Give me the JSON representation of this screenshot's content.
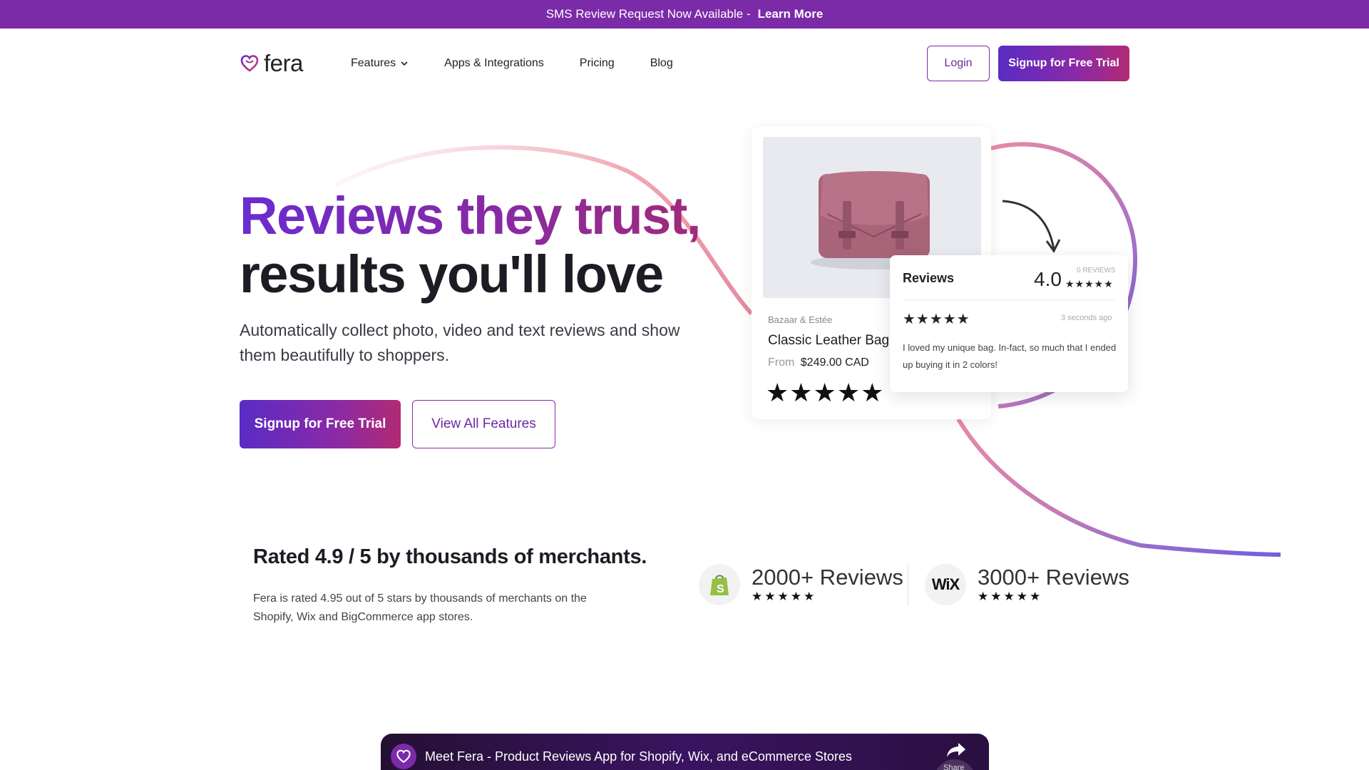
{
  "announcement": {
    "text": "SMS Review Request Now Available -",
    "link": "Learn More"
  },
  "header": {
    "logo_text": "fera",
    "nav": [
      {
        "label": "Features"
      },
      {
        "label": "Apps & Integrations"
      },
      {
        "label": "Pricing"
      },
      {
        "label": "Blog"
      }
    ],
    "login_label": "Login",
    "signup_label": "Signup for Free Trial"
  },
  "hero": {
    "title_line1": "Reviews they trust,",
    "title_line2": "results you'll love",
    "subtitle": "Automatically collect photo, video and text reviews and show them beautifully to shoppers.",
    "primary_cta": "Signup for Free Trial",
    "secondary_cta": "View All Features"
  },
  "product_card": {
    "brand": "Bazaar & Estée",
    "name": "Classic Leather Bag",
    "price_prefix": "From",
    "price": "$249.00 CAD",
    "stars": "★★★★★",
    "rating_value": 5
  },
  "reviews_widget": {
    "title": "Reviews",
    "score": "4.0",
    "count_label": "0 REVIEWS",
    "mini_stars": "★★★★★",
    "review_stars": "★★★★★",
    "time": "3 seconds ago",
    "text": "I loved my unique bag. In-fact, so much that I ended up buying it in 2 colors!"
  },
  "rated": {
    "title": "Rated 4.9 / 5 by thousands of merchants.",
    "text": "Fera is rated 4.95 out of 5 stars by thousands of merchants on the Shopify, Wix and BigCommerce app stores."
  },
  "badges": {
    "shopify": {
      "count": "2000+ Reviews",
      "stars": "★★★★★"
    },
    "wix": {
      "logo": "WiX",
      "count": "3000+ Reviews",
      "stars": "★★★★★"
    }
  },
  "video": {
    "title": "Meet Fera - Product Reviews App for Shopify, Wix, and eCommerce Stores",
    "share_label": "Share"
  },
  "colors": {
    "brand_purple": "#7b2aa8",
    "gradient_start": "#5a2bc4",
    "gradient_end": "#b22a73"
  },
  "icons": [
    "heart-logo-icon",
    "chevron-down-icon",
    "shopping-bag-icon",
    "shopify-icon",
    "share-icon",
    "arrow-icon"
  ]
}
